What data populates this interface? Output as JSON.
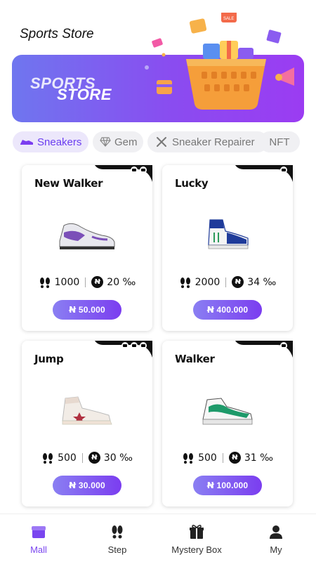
{
  "header": {
    "title": "Sports Store"
  },
  "banner": {
    "line1": "SPORTS",
    "line2": "STORE",
    "sale_tag": "SALE"
  },
  "tabs": [
    {
      "label": "Sneakers",
      "icon": "sneaker-icon",
      "active": true
    },
    {
      "label": "Gem",
      "icon": "gem-icon",
      "active": false
    },
    {
      "label": "Sneaker Repairer",
      "icon": "tools-icon",
      "active": false
    },
    {
      "label": "NFT",
      "icon": "",
      "active": false
    }
  ],
  "products": [
    {
      "name": "New Walker",
      "steps": "1000",
      "rate": "20 ‰",
      "price": "Ꞥ 50.000",
      "shoe_color": "#7b4fb8"
    },
    {
      "name": "Lucky",
      "steps": "2000",
      "rate": "34 ‰",
      "price": "Ꞥ 400.000",
      "shoe_color": "#1f3b9a"
    },
    {
      "name": "Jump",
      "steps": "500",
      "rate": "30 ‰",
      "price": "Ꞥ 30.000",
      "shoe_color": "#b03040"
    },
    {
      "name": "Walker",
      "steps": "500",
      "rate": "31 ‰",
      "price": "Ꞥ 100.000",
      "shoe_color": "#1e9a6a"
    }
  ],
  "tabbar": [
    {
      "label": "Mall",
      "icon": "mall-icon",
      "active": true
    },
    {
      "label": "Step",
      "icon": "footprints-icon",
      "active": false
    },
    {
      "label": "Mystery Box",
      "icon": "gift-icon",
      "active": false
    },
    {
      "label": "My",
      "icon": "user-icon",
      "active": false
    }
  ],
  "colors": {
    "accent": "#7b3df0",
    "banner_start": "#6f76ef",
    "banner_end": "#9b3cf2"
  }
}
